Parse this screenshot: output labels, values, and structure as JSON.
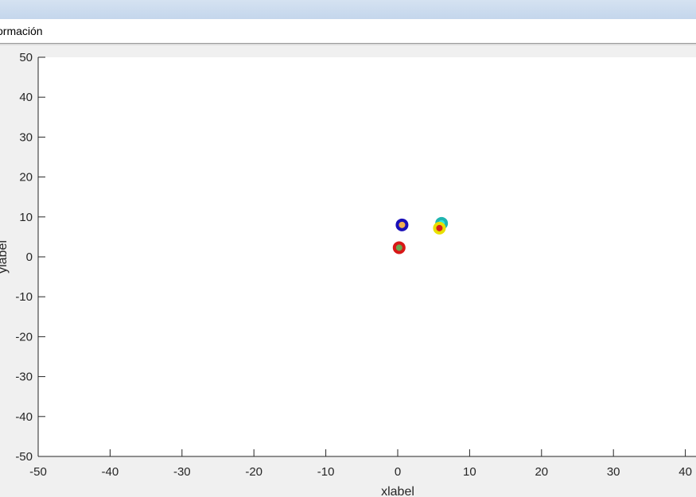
{
  "window": {
    "menu_item": "ormación"
  },
  "chart_data": {
    "type": "scatter",
    "title": "",
    "xlabel": "xlabel",
    "ylabel": "ylabel",
    "xlim": [
      -50,
      40
    ],
    "ylim": [
      -50,
      50
    ],
    "xticks": [
      -50,
      -40,
      -30,
      -20,
      -10,
      0,
      10,
      20,
      30,
      40
    ],
    "yticks": [
      -50,
      -40,
      -30,
      -20,
      -10,
      0,
      10,
      20,
      30,
      40,
      50
    ],
    "xtick_labels": [
      "-50",
      "-40",
      "-30",
      "-20",
      "-10",
      "0",
      "10",
      "20",
      "30",
      "40"
    ],
    "ytick_labels": [
      "-50",
      "-40",
      "-30",
      "-20",
      "-10",
      "0",
      "10",
      "20",
      "30",
      "40",
      "50"
    ],
    "grid": false,
    "points": [
      {
        "x": 0.6,
        "y": 8.0,
        "fill": "#f0b050",
        "edge": "#1a0fb8"
      },
      {
        "x": 0.2,
        "y": 2.3,
        "fill": "#6aa84f",
        "edge": "#d81818"
      },
      {
        "x": 6.1,
        "y": 8.4,
        "fill": "#2ee8e0",
        "edge": "#1fb5b0"
      },
      {
        "x": 5.8,
        "y": 7.2,
        "fill": "#d61f1f",
        "edge": "#e8e000"
      }
    ]
  }
}
